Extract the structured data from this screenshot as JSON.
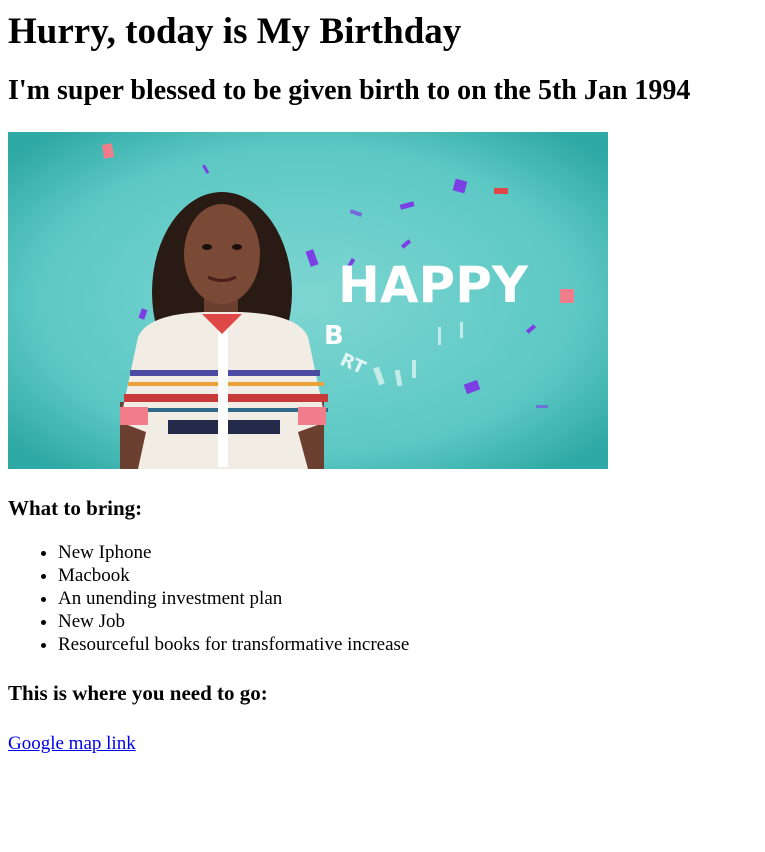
{
  "page": {
    "title": "Hurry, today is My Birthday",
    "subtitle": "I'm super blessed to be given birth to on the 5th Jan 1994"
  },
  "hero_image": {
    "description_icon": "birthday-gif-image",
    "overlay_text": "HAPPY",
    "overlay_sub_letters": "B",
    "overlay_sub_letters_2": "RT",
    "colors": {
      "background": "#5cc8c4",
      "background_dark": "#2fa9a5",
      "text": "#ffffff",
      "confetti_purple": "#7b3fe4",
      "confetti_pink": "#f27d8a",
      "confetti_red": "#e04848"
    }
  },
  "bring": {
    "heading": "What to bring:",
    "items": [
      "New Iphone",
      "Macbook",
      "An unending investment plan",
      "New Job",
      "Resourceful books for transformative increase"
    ]
  },
  "go": {
    "heading": "This is where you need to go:",
    "link_label": "Google map link"
  }
}
